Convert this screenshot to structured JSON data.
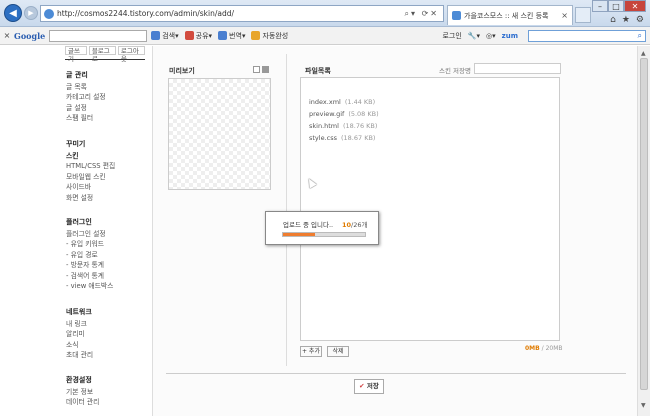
{
  "browser": {
    "url": "http://cosmos2244.tistory.com/admin/skin/add/",
    "tab_title": "가을코스모스 :: 새 스킨 등록",
    "tab_close": "×",
    "toolbar_close": "×",
    "google_label": "Google",
    "toolbar_items": [
      "검색",
      "공유",
      "번역",
      "자동완성"
    ],
    "login_label": "로그인",
    "zum_label": "zum"
  },
  "sidebar": {
    "topnav": [
      "글쓰기",
      "블로그로",
      "로그아웃"
    ],
    "sections": [
      {
        "title": "글 관리",
        "items": [
          "글 목록",
          "카테고리 설정",
          "글 설정",
          "스팸 필터"
        ]
      },
      {
        "title": "꾸미기",
        "items": [
          "스킨",
          "HTML/CSS 편집",
          "모바일웹 스킨",
          "사이드바",
          "화면 설정"
        ]
      },
      {
        "title": "플러그인",
        "items": [
          "플러그인 설정",
          "- 유입 키워드",
          "- 유입 경로",
          "- 방문자 통계",
          "- 검색어 통계",
          "- view 애드박스"
        ]
      },
      {
        "title": "네트워크",
        "items": [
          "내 링크",
          "알리미",
          "소식",
          "초대 관리"
        ]
      },
      {
        "title": "환경설정",
        "items": [
          "기본 정보",
          "데이터 관리"
        ]
      }
    ]
  },
  "preview": {
    "title": "미리보기"
  },
  "files": {
    "title": "파일목록",
    "skin_name_label": "스킨 저장명",
    "items": [
      {
        "name": "index.xml",
        "size": "(1.44 KB)"
      },
      {
        "name": "preview.gif",
        "size": "(5.08 KB)"
      },
      {
        "name": "skin.html",
        "size": "(18.76 KB)"
      },
      {
        "name": "style.css",
        "size": "(18.67 KB)"
      }
    ],
    "add_label": "+ 추가",
    "delete_label": "삭제",
    "usage_used": "0MB",
    "usage_total": "/ 20MB"
  },
  "save_label": "저장",
  "save_mark": "✔",
  "upload": {
    "message": "업로드 중 입니다..",
    "current": "10",
    "total": "/26개",
    "progress_fraction": 0.385,
    "progress_color": "#ef7d2f"
  }
}
